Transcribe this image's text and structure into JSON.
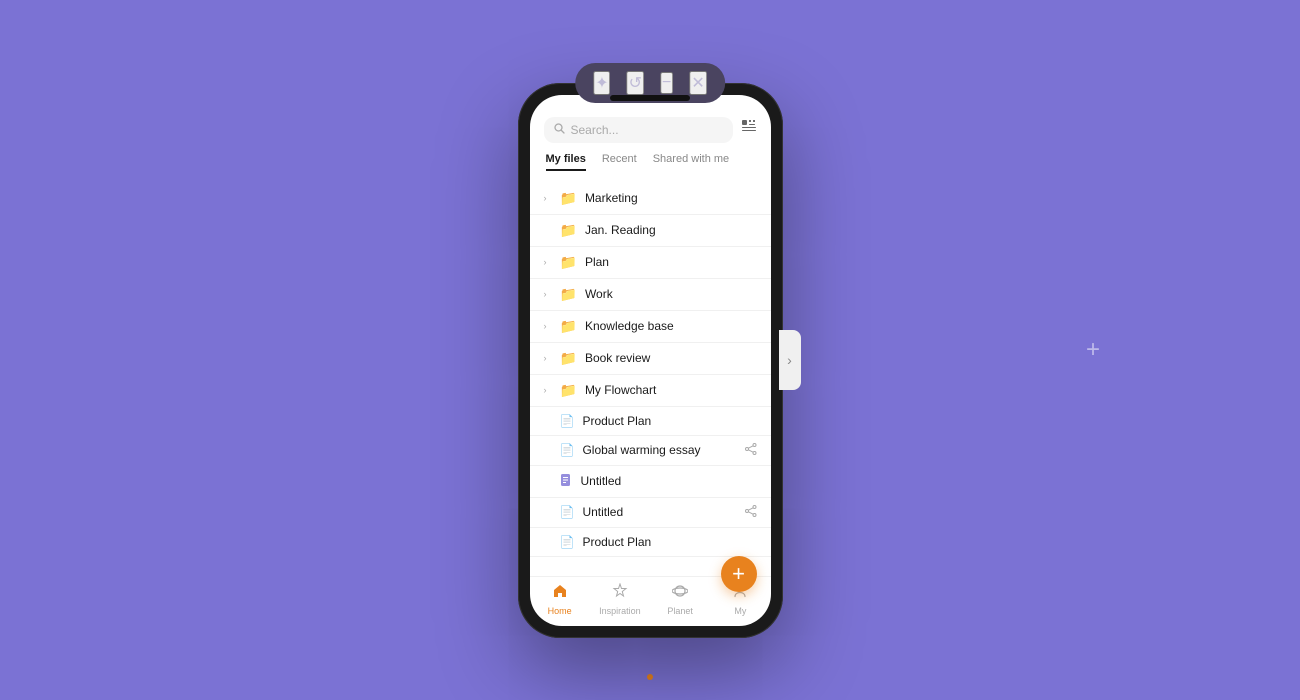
{
  "background": {
    "color": "#7b72d4"
  },
  "window_controls": {
    "buttons": [
      {
        "id": "star",
        "icon": "✦",
        "label": "star-button"
      },
      {
        "id": "refresh",
        "icon": "↺",
        "label": "refresh-button"
      },
      {
        "id": "minimize",
        "icon": "−",
        "label": "minimize-button"
      },
      {
        "id": "close",
        "icon": "✕",
        "label": "close-button"
      }
    ]
  },
  "search": {
    "placeholder": "Search...",
    "icon": "🔍"
  },
  "grid_icon": "⊞",
  "tabs": [
    {
      "id": "my-files",
      "label": "My files",
      "active": true
    },
    {
      "id": "recent",
      "label": "Recent",
      "active": false
    },
    {
      "id": "shared",
      "label": "Shared with me",
      "active": false
    }
  ],
  "files": [
    {
      "id": 1,
      "type": "folder",
      "name": "Marketing",
      "has_chevron": true,
      "shared": false
    },
    {
      "id": 2,
      "type": "folder",
      "name": "Jan. Reading",
      "has_chevron": false,
      "shared": false
    },
    {
      "id": 3,
      "type": "folder",
      "name": "Plan",
      "has_chevron": true,
      "shared": false
    },
    {
      "id": 4,
      "type": "folder",
      "name": "Work",
      "has_chevron": true,
      "shared": false
    },
    {
      "id": 5,
      "type": "folder",
      "name": "Knowledge base",
      "has_chevron": true,
      "shared": false
    },
    {
      "id": 6,
      "type": "folder",
      "name": "Book review",
      "has_chevron": true,
      "shared": false
    },
    {
      "id": 7,
      "type": "folder",
      "name": "My Flowchart",
      "has_chevron": true,
      "shared": false
    },
    {
      "id": 8,
      "type": "doc",
      "name": "Product Plan",
      "has_chevron": false,
      "shared": false
    },
    {
      "id": 9,
      "type": "doc",
      "name": "Global warming essay",
      "has_chevron": false,
      "shared": true
    },
    {
      "id": 10,
      "type": "doc-blue",
      "name": "Untitled",
      "has_chevron": false,
      "shared": false
    },
    {
      "id": 11,
      "type": "doc",
      "name": "Untitled",
      "has_chevron": false,
      "shared": true
    },
    {
      "id": 12,
      "type": "doc",
      "name": "Product Plan",
      "has_chevron": false,
      "shared": false
    }
  ],
  "fab": {
    "label": "+"
  },
  "bottom_nav": [
    {
      "id": "home",
      "label": "Home",
      "icon": "⌂",
      "active": true
    },
    {
      "id": "inspiration",
      "label": "Inspiration",
      "icon": "☆",
      "active": false
    },
    {
      "id": "planet",
      "label": "Planet",
      "icon": "◎",
      "active": false
    },
    {
      "id": "my",
      "label": "My",
      "icon": "◯",
      "active": false
    }
  ]
}
